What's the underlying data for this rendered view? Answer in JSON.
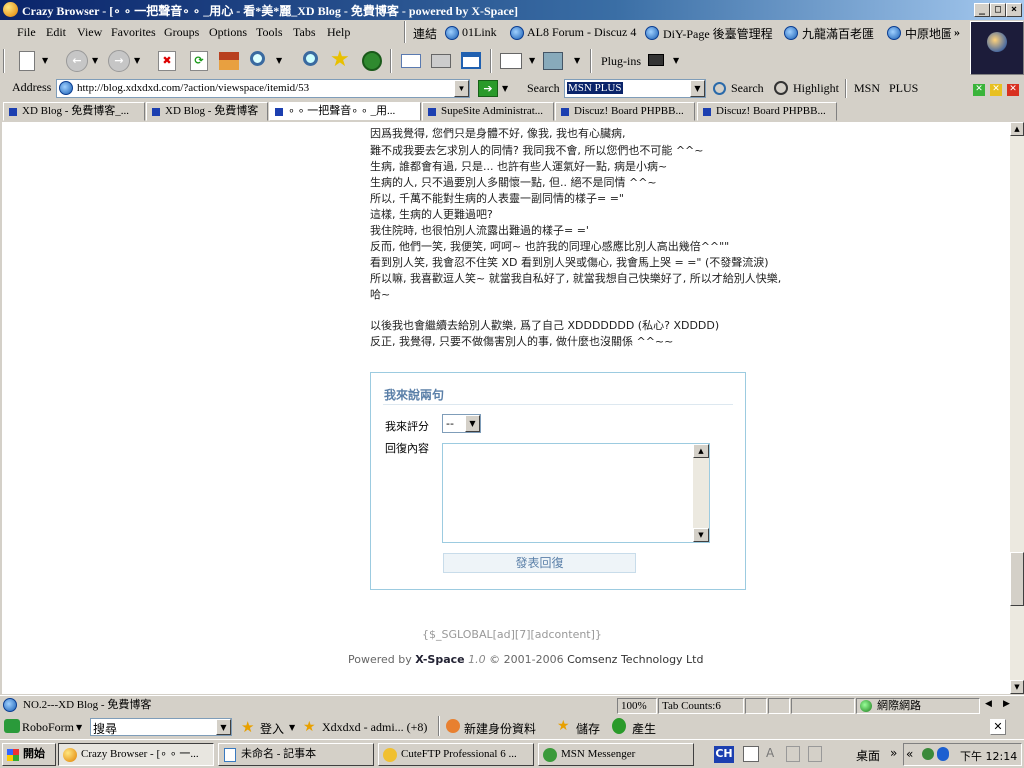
{
  "window": {
    "title": "Crazy Browser - [∘ ∘ 一把聲音∘ ∘ _用心 - 看*美*麗_XD Blog - 免費博客 - powered by X-Space]",
    "controls": {
      "minimize": "_",
      "maximize": "□",
      "close": "×"
    }
  },
  "menu": [
    "File",
    "Edit",
    "View",
    "Favorites",
    "Groups",
    "Options",
    "Tools",
    "Tabs",
    "Help"
  ],
  "links": {
    "label": "連結",
    "items": [
      "01Link",
      "AL8 Forum - Discuz 4",
      "DiY-Page 後臺管理程",
      "九龍滿百老匯",
      "中原地圖"
    ],
    "more": "»"
  },
  "toolbar": {
    "plugins_label": "Plug-ins"
  },
  "address": {
    "label": "Address",
    "url": "http://blog.xdxdxd.com/?action/viewspace/itemid/53"
  },
  "search": {
    "label": "Search",
    "value": "MSN PLUS",
    "search_button": "Search",
    "highlight_button": "Highlight",
    "msn": "MSN",
    "plus": "PLUS"
  },
  "tabs": [
    {
      "label": "XD Blog - 免費博客_..."
    },
    {
      "label": "XD Blog - 免費博客"
    },
    {
      "label": "∘ ∘ 一把聲音∘ ∘ _用..."
    },
    {
      "label": "SupeSite Administrat..."
    },
    {
      "label": "Discuz! Board PHPBB..."
    },
    {
      "label": "Discuz! Board PHPBB..."
    }
  ],
  "post": {
    "lines": [
      "因爲我覺得, 您們只是身體不好, 像我, 我也有心臟病,",
      "難不成我要去乞求別人的同情? 我同我不會, 所以您們也不可能 ^^~",
      "生病, 誰都會有過, 只是... 也許有些人運氣好一點, 病是小病~",
      "生病的人, 只不過要別人多關懷一點, 但.. 絕不是同情 ^^~",
      "所以, 千萬不能對生病的人表靈一副同情的樣子= =\"",
      "這樣, 生病的人更難過吧?",
      "我住院時, 也很怕別人流露出難過的樣子= ='",
      "反而, 他們一笑, 我便笑, 呵呵~ 也許我的同理心感應比別人高出幾倍^^\"\"",
      "看到別人笑, 我會忍不住笑 XD 看到別人哭或傷心, 我會馬上哭 = =\" (不發聲流淚)",
      "所以嘛, 我喜歡逗人笑~ 就當我自私好了, 就當我想自己快樂好了, 所以才給別人快樂,",
      "哈~",
      "",
      "以後我也會繼續去給別人歡樂, 爲了自己 XDDDDDDD (私心? XDDDD)",
      "反正, 我覺得, 只要不做傷害別人的事, 做什麼也沒關係 ^^~~"
    ]
  },
  "comment": {
    "heading": "我來說兩句",
    "rating_label": "我來評分",
    "rating_value": "--",
    "content_label": "回復內容",
    "submit": "發表回復"
  },
  "footer": {
    "ad": "{$_SGLOBAL[ad][7][adcontent]}",
    "powered_prefix": "Powered by ",
    "powered_brand": "X-Space",
    "powered_version": " 1.0 ",
    "powered_copy": "© 2001-2006 ",
    "powered_company": "Comsenz Technology Ltd"
  },
  "status": {
    "page": "NO.2---XD Blog - 免費博客",
    "zoom": "100%",
    "tab_count": "Tab Counts:6",
    "zone": "網際網路"
  },
  "roboform": {
    "label": "RoboForm",
    "search_value": "搜尋",
    "login": "登入",
    "identity": "Xdxdxd - admi... (+8)",
    "new_identity": "新建身份資料",
    "save": "儲存",
    "generate": "產生"
  },
  "taskbar": {
    "start": "開始",
    "tasks": [
      "Crazy Browser - [∘ ∘ 一...",
      "未命名 - 記事本",
      "CuteFTP Professional 6 ...",
      "MSN Messenger"
    ],
    "ime": "CH",
    "desktop": "桌面",
    "clock": "下午 12:14"
  },
  "colors": {
    "title_start": "#0a246a",
    "chrome": "#d4d0c8",
    "tab_marker": "#1c3fb0",
    "comment_border": "#9ccbe0",
    "comment_heading": "#5a7fa8"
  }
}
